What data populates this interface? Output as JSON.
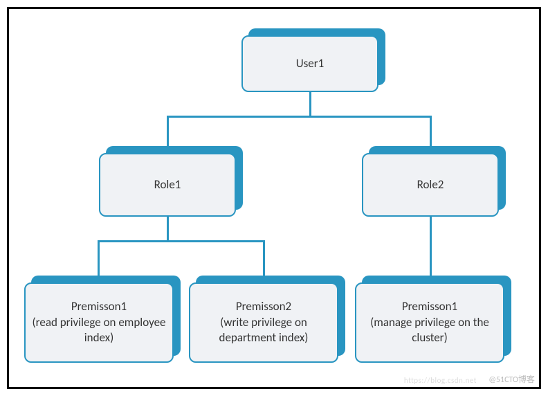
{
  "diagram": {
    "user": {
      "label": "User1"
    },
    "roles": [
      {
        "label": "Role1"
      },
      {
        "label": "Role2"
      }
    ],
    "permissions": [
      {
        "title": "Premisson1",
        "desc": "(read privilege on employee index)"
      },
      {
        "title": "Premisson2",
        "desc": "(write privilege on department index)"
      },
      {
        "title": "Premisson1",
        "desc": "(manage privilege on the cluster)"
      }
    ]
  },
  "watermark": {
    "right": "@51CTO博客",
    "left_faint": "https://blog.csdn.net"
  },
  "colors": {
    "accent": "#2995c1",
    "box_bg": "#f0f2f5",
    "border": "#000"
  }
}
